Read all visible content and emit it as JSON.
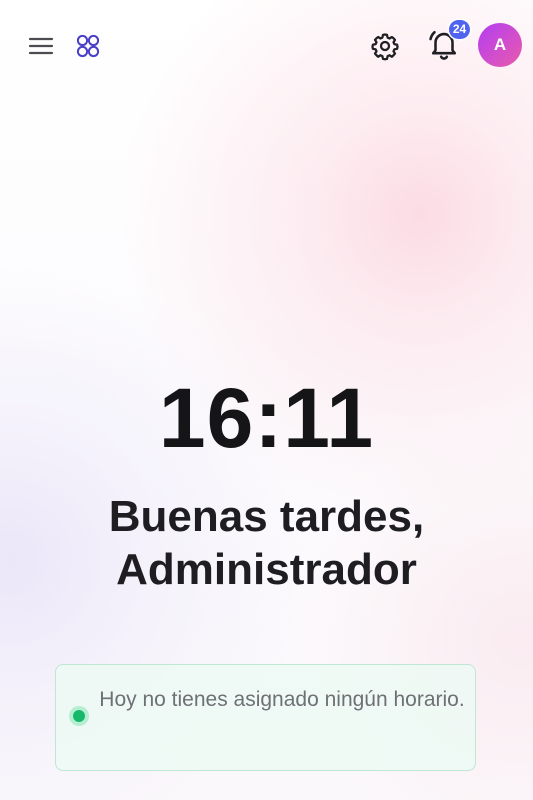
{
  "header": {
    "menu_icon": "hamburger-menu-icon",
    "apps_icon": "apps-grid-icon",
    "settings_icon": "gear-icon",
    "notifications_icon": "bell-icon",
    "notification_count": "24",
    "avatar_initial": "A"
  },
  "main": {
    "time": "16:11",
    "greeting": "Buenas tardes, Administrador"
  },
  "schedule": {
    "message": "Hoy no tienes asignado ningún horario.",
    "status_color": "#16b86a"
  },
  "colors": {
    "accent": "#4f63f0",
    "avatar_gradient_start": "#b13cf2",
    "avatar_gradient_end": "#e85aa8"
  }
}
